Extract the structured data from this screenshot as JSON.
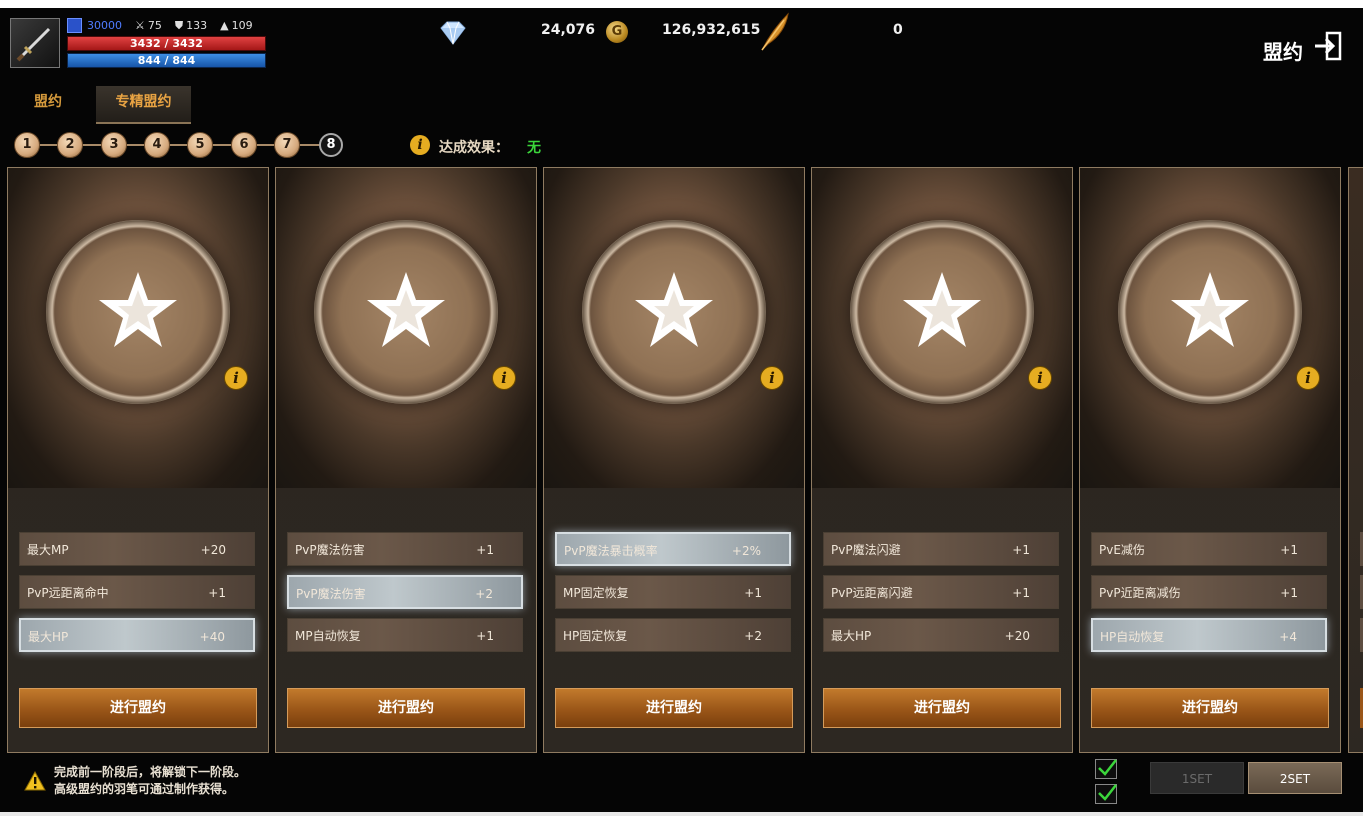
{
  "header": {
    "level_value": "30000",
    "attack": "75",
    "defense": "133",
    "magic": "109",
    "hp": "3432 / 3432",
    "mp": "844 / 844",
    "diamonds": "24,076",
    "gold_label": "G",
    "gold": "126,932,615",
    "quill": "0",
    "title": "盟约"
  },
  "tabs": [
    "盟约",
    "专精盟约"
  ],
  "active_tab": 1,
  "stages": [
    "1",
    "2",
    "3",
    "4",
    "5",
    "6",
    "7",
    "8"
  ],
  "current_stage": 8,
  "effect": {
    "label": "达成效果：",
    "value": "无"
  },
  "info_glyph": "i",
  "cards": [
    {
      "rows": [
        {
          "name": "最大MP",
          "value": "+20",
          "selected": false
        },
        {
          "name": "PvP远距离命中",
          "value": "+1",
          "selected": false
        },
        {
          "name": "最大HP",
          "value": "+40",
          "selected": true
        }
      ],
      "button": "进行盟约"
    },
    {
      "rows": [
        {
          "name": "PvP魔法伤害",
          "value": "+1",
          "selected": false
        },
        {
          "name": "PvP魔法伤害",
          "value": "+2",
          "selected": true
        },
        {
          "name": "MP自动恢复",
          "value": "+1",
          "selected": false
        }
      ],
      "button": "进行盟约"
    },
    {
      "rows": [
        {
          "name": "PvP魔法暴击概率",
          "value": "+2%",
          "selected": true
        },
        {
          "name": "MP固定恢复",
          "value": "+1",
          "selected": false
        },
        {
          "name": "HP固定恢复",
          "value": "+2",
          "selected": false
        }
      ],
      "button": "进行盟约"
    },
    {
      "rows": [
        {
          "name": "PvP魔法闪避",
          "value": "+1",
          "selected": false
        },
        {
          "name": "PvP远距离闪避",
          "value": "+1",
          "selected": false
        },
        {
          "name": "最大HP",
          "value": "+20",
          "selected": false
        }
      ],
      "button": "进行盟约"
    },
    {
      "rows": [
        {
          "name": "PvE减伤",
          "value": "+1",
          "selected": false
        },
        {
          "name": "PvP近距离减伤",
          "value": "+1",
          "selected": false
        },
        {
          "name": "HP自动恢复",
          "value": "+4",
          "selected": true
        }
      ],
      "button": "进行盟约"
    }
  ],
  "footer": {
    "notice_line1": "完成前一阶段后，将解锁下一阶段。",
    "notice_line2": "高级盟约的羽笔可通过制作获得。",
    "set1": "1SET",
    "set2": "2SET"
  },
  "colors": {
    "accent": "#e8a343",
    "effect_value": "#3bd63b",
    "button": "#9a5618",
    "selected_row": "#bfc8cc"
  }
}
